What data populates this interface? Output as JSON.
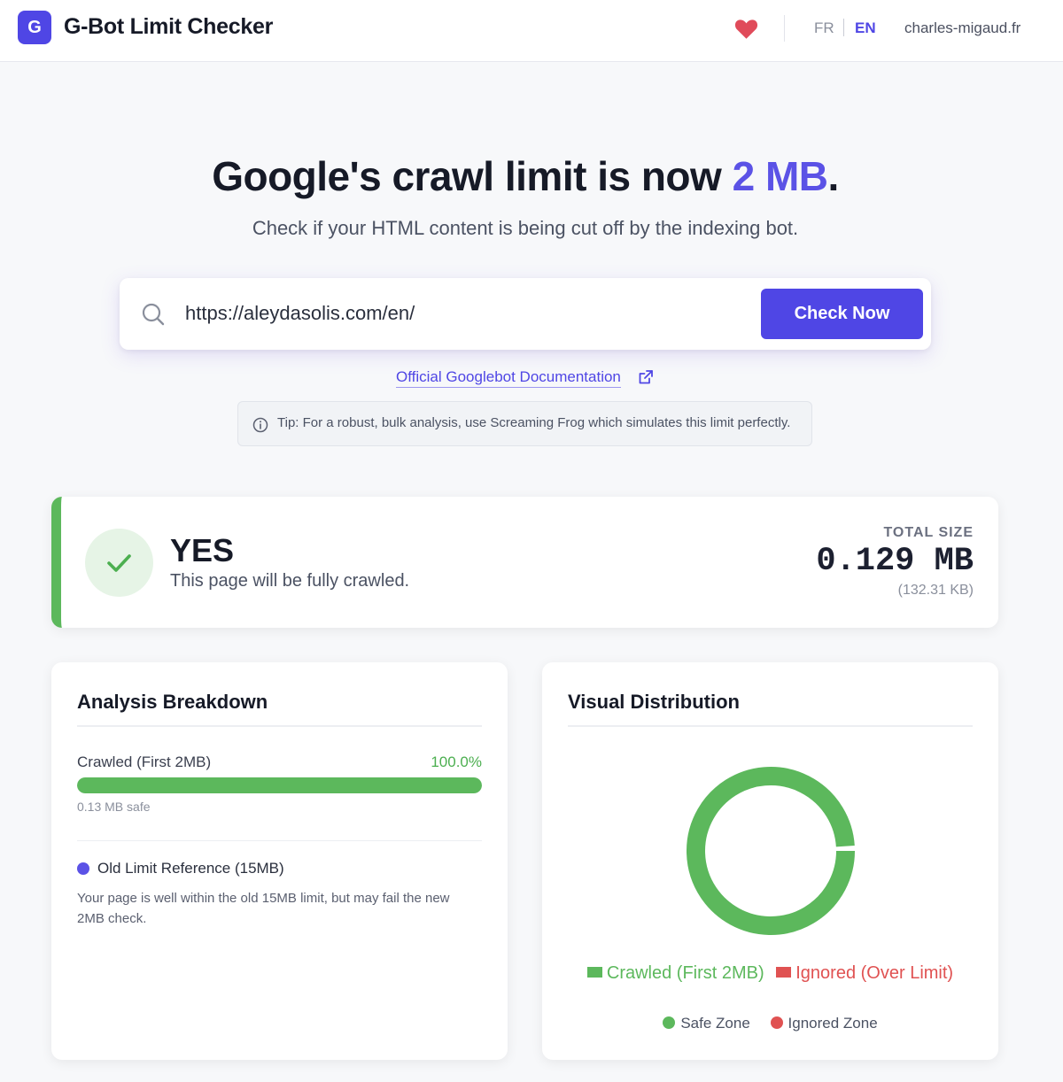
{
  "header": {
    "logo_letter": "G",
    "title": "G-Bot Limit Checker",
    "lang_fr": "FR",
    "lang_en": "EN",
    "site": "charles-migaud.fr"
  },
  "hero": {
    "title_prefix": "Google's crawl limit is now ",
    "title_accent": "2 MB",
    "title_suffix": ".",
    "subtitle": "Check if your HTML content is being cut off by the indexing bot."
  },
  "search": {
    "value": "https://aleydasolis.com/en/",
    "button_label": "Check Now"
  },
  "doc_link": "Official Googlebot Documentation",
  "tip": "Tip: For a robust, bulk analysis, use Screaming Frog which simulates this limit perfectly.",
  "result": {
    "verdict": "YES",
    "message": "This page will be fully crawled.",
    "size_label": "TOTAL SIZE",
    "size_mb": "0.129 MB",
    "size_kb": "(132.31 KB)"
  },
  "breakdown": {
    "title": "Analysis Breakdown",
    "bar_label": "Crawled (First 2MB)",
    "bar_percent_text": "100.0%",
    "bar_fraction": 1.0,
    "bar_note": "0.13 MB safe",
    "ref_title": "Old Limit Reference (15MB)",
    "ref_text": "Your page is well within the old 15MB limit, but may fail the new 2MB check."
  },
  "distribution": {
    "title": "Visual Distribution",
    "crawled_fraction": 0.99,
    "legend_crawled": "Crawled (First 2MB)",
    "legend_ignored": "Ignored (Over Limit)",
    "zone_safe": "Safe Zone",
    "zone_ignored": "Ignored Zone"
  },
  "colors": {
    "accent": "#4f46e5",
    "safe": "#5cb85c",
    "danger": "#e05252",
    "heart": "#e04b5a"
  }
}
